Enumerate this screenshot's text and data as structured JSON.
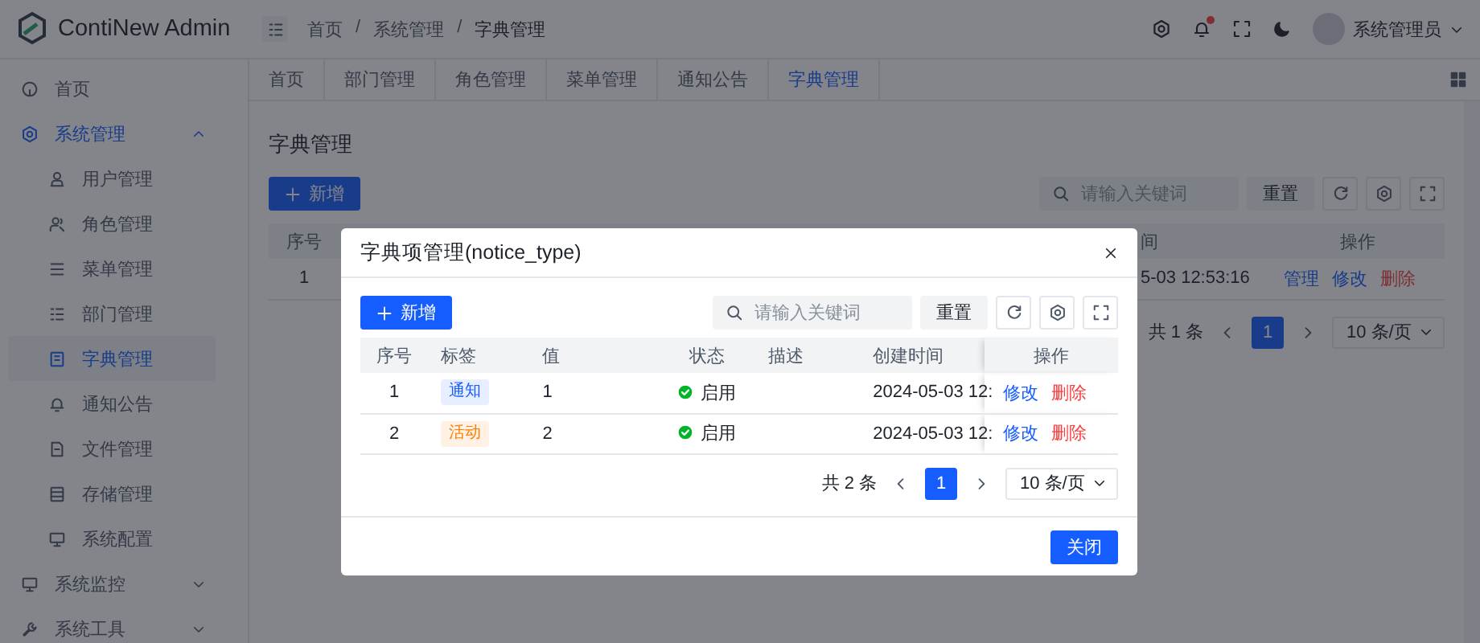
{
  "app": {
    "logo_text": "ContiNew Admin"
  },
  "header": {
    "breadcrumb": {
      "separator": "/",
      "items": [
        "首页",
        "系统管理",
        "字典管理"
      ]
    },
    "notification_dot": true,
    "user_name": "系统管理员"
  },
  "sidebar": {
    "items": [
      {
        "label": "首页",
        "expanded": false
      },
      {
        "label": "系统管理",
        "expanded": true,
        "children": [
          {
            "label": "用户管理",
            "selected": false
          },
          {
            "label": "角色管理",
            "selected": false
          },
          {
            "label": "菜单管理",
            "selected": false
          },
          {
            "label": "部门管理",
            "selected": false
          },
          {
            "label": "字典管理",
            "selected": true
          },
          {
            "label": "通知公告",
            "selected": false
          },
          {
            "label": "文件管理",
            "selected": false
          },
          {
            "label": "存储管理",
            "selected": false
          },
          {
            "label": "系统配置",
            "selected": false
          }
        ]
      },
      {
        "label": "系统监控",
        "expanded": false
      },
      {
        "label": "系统工具",
        "expanded": false
      }
    ]
  },
  "tabs": [
    {
      "label": "首页",
      "selected": false
    },
    {
      "label": "部门管理",
      "selected": false
    },
    {
      "label": "角色管理",
      "selected": false
    },
    {
      "label": "菜单管理",
      "selected": false
    },
    {
      "label": "通知公告",
      "selected": false
    },
    {
      "label": "字典管理",
      "selected": true
    }
  ],
  "page": {
    "title": "字典管理",
    "add_button": "新增",
    "search": {
      "placeholder": "请输入关键词"
    },
    "reset_button": "重置",
    "table": {
      "columns": [
        "序号",
        "",
        "间",
        "操作"
      ],
      "rows": [
        {
          "cells": [
            "1",
            "",
            "5-03 12:53:16"
          ],
          "actions": [
            {
              "label": "管理",
              "kind": "primary",
              "disabled": false
            },
            {
              "label": "修改",
              "kind": "primary",
              "disabled": false
            },
            {
              "label": "删除",
              "kind": "danger",
              "disabled": false
            }
          ]
        }
      ]
    },
    "pagination": {
      "total": "共 1 条",
      "pages": [
        {
          "label": "1",
          "selected": true
        }
      ],
      "page_size": "10 条/页"
    }
  },
  "modal": {
    "title": "字典项管理(notice_type)",
    "add_button": "新增",
    "search": {
      "placeholder": "请输入关键词"
    },
    "reset_button": "重置",
    "table": {
      "columns": [
        "序号",
        "标签",
        "值",
        "状态",
        "描述",
        "创建时间",
        "操作"
      ],
      "rows": [
        {
          "index": "1",
          "tag": {
            "text": "通知",
            "color": "#165dff"
          },
          "value": "1",
          "status": {
            "text": "启用",
            "enabled": true
          },
          "created": "2024-05-03 12:",
          "actions": [
            {
              "label": "修改",
              "kind": "primary",
              "disabled": false
            },
            {
              "label": "删除",
              "kind": "danger",
              "disabled": false
            }
          ]
        },
        {
          "index": "2",
          "tag": {
            "text": "活动",
            "color": "#ff7d00"
          },
          "value": "2",
          "status": {
            "text": "启用",
            "enabled": true
          },
          "created": "2024-05-03 12:",
          "actions": [
            {
              "label": "修改",
              "kind": "primary",
              "disabled": false
            },
            {
              "label": "删除",
              "kind": "danger",
              "disabled": false
            }
          ]
        }
      ]
    },
    "pagination": {
      "total": "共 2 条",
      "pages": [
        {
          "label": "1",
          "selected": true
        }
      ],
      "page_size": "10 条/页"
    },
    "close_button": "关闭"
  }
}
